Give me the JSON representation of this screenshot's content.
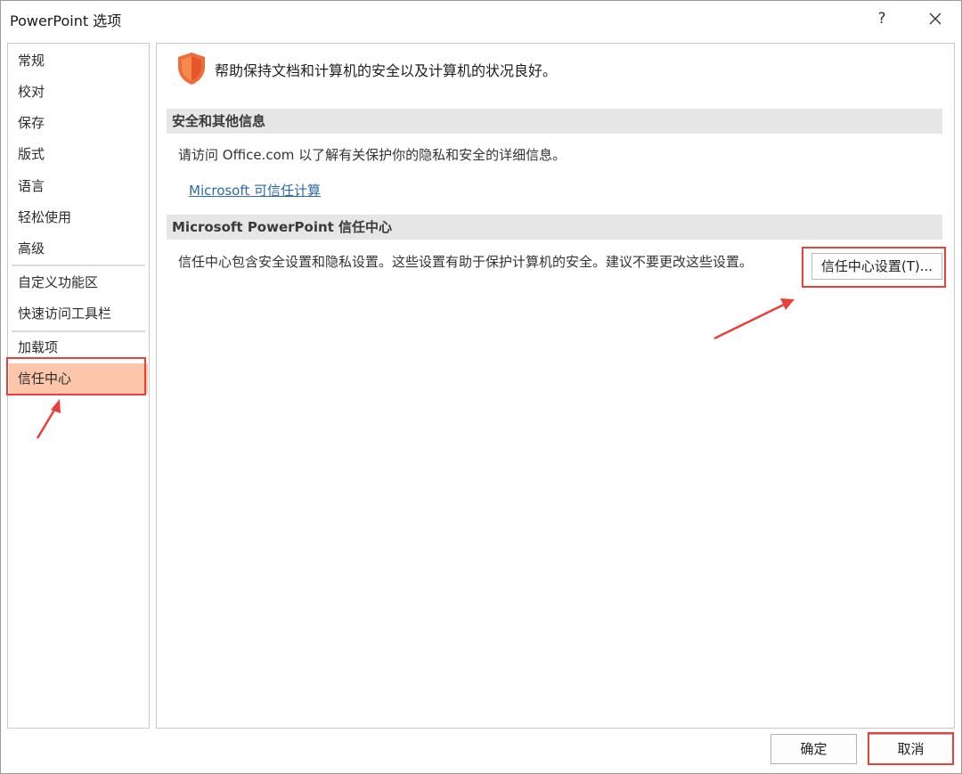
{
  "window": {
    "title": "PowerPoint 选项",
    "help_label": "?"
  },
  "sidebar": {
    "items": [
      {
        "label": "常规"
      },
      {
        "label": "校对"
      },
      {
        "label": "保存"
      },
      {
        "label": "版式"
      },
      {
        "label": "语言"
      },
      {
        "label": "轻松使用"
      },
      {
        "label": "高级"
      },
      {
        "label": "自定义功能区"
      },
      {
        "label": "快速访问工具栏"
      },
      {
        "label": "加载项"
      },
      {
        "label": "信任中心"
      }
    ],
    "selected": "信任中心"
  },
  "main": {
    "header": "帮助保持文档和计算机的安全以及计算机的状况良好。",
    "security_section": {
      "title": "安全和其他信息",
      "text": "请访问 Office.com 以了解有关保护你的隐私和安全的详细信息。",
      "link": "Microsoft 可信任计算"
    },
    "trust_section": {
      "title": "Microsoft PowerPoint 信任中心",
      "text": "信任中心包含安全设置和隐私设置。这些设置有助于保护计算机的安全。建议不要更改这些设置。",
      "button": "信任中心设置(T)..."
    }
  },
  "footer": {
    "ok": "确定",
    "cancel": "取消"
  },
  "colors": {
    "selected_bg": "#fbc6aa",
    "highlight": "#e8413b",
    "shield": "#ef6b3b",
    "link": "#2b6aa8"
  },
  "icons": [
    "shield-icon",
    "close-icon"
  ]
}
